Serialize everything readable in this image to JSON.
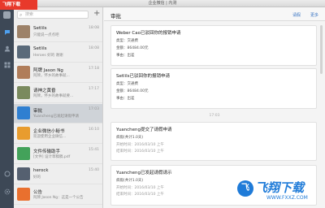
{
  "watermark_top": "飞翔下载",
  "window": {
    "title": "企业微信 | 内测"
  },
  "search": {
    "placeholder": "搜索"
  },
  "list": {
    "add_label": "+",
    "items": [
      {
        "name": "Setlils",
        "preview": "只能说一点点吧",
        "time": "18:08",
        "color": "#9d8269"
      },
      {
        "name": "Setlils",
        "preview": "Heroes 好的 谢谢",
        "time": "18:08",
        "color": "#5a6a7a"
      },
      {
        "name": "阿牌 Jason Ng",
        "preview": "阿牌，怀乡的故事就...",
        "time": "17:18",
        "color": "#b07d5a"
      },
      {
        "name": "请神之黄昏",
        "preview": "阿牌，怀乡的故事就要...",
        "time": "17:17",
        "color": "#7a8a5e"
      },
      {
        "name": "审批",
        "preview": "Yuancheng已发起请假申请",
        "time": "17:03",
        "color": "#2f7fd1"
      },
      {
        "name": "企业微信小秘书",
        "preview": "欢迎使用企业微信...",
        "time": "16:10",
        "color": "#e89c2e"
      },
      {
        "name": "文件传输助手",
        "preview": "[文件] 设计草稿稿.pdf",
        "time": "15:41",
        "color": "#43a25a"
      },
      {
        "name": "herock",
        "preview": "好的",
        "time": "15:40",
        "color": "#556070"
      },
      {
        "name": "公告",
        "preview": "阿牌 Jason Ng：这是一个公告",
        "time": "",
        "color": "#e9702e"
      }
    ]
  },
  "main": {
    "title": "审批",
    "link_apply": "请假",
    "link_more": "更多",
    "divider_time": "17:03",
    "cards": [
      {
        "title": "Weber Cao已驳回你的报销申请",
        "lines": [
          "类型：交通费",
          "金额：86484.00元",
          "事由：出差"
        ]
      },
      {
        "title": "Setlils已驳回你的报销申请",
        "lines": [
          "类型：交通费",
          "金额：86484.00元",
          "事由：出差"
        ]
      },
      {
        "title": "Yuancheng提交了请假申请",
        "lines": [
          "病假(共计1.0天)",
          "开始时间：2016/03/10 上午",
          "结束时间：2016/03/10 上午"
        ]
      },
      {
        "title": "Yuancheng已发起请假请示",
        "lines": [
          "病假(共计1.0天)",
          "开始时间：2016/03/10 上午",
          "结束时间：2016/03/10 上午"
        ]
      }
    ]
  },
  "watermark_bottom": {
    "logo": "飞",
    "title": "飞翔下载",
    "url": "WWW.FXXZ.COM"
  },
  "rail_icons": [
    "chat-icon",
    "contacts-icon",
    "workbench-icon",
    "me-icon",
    "settings-icon"
  ]
}
